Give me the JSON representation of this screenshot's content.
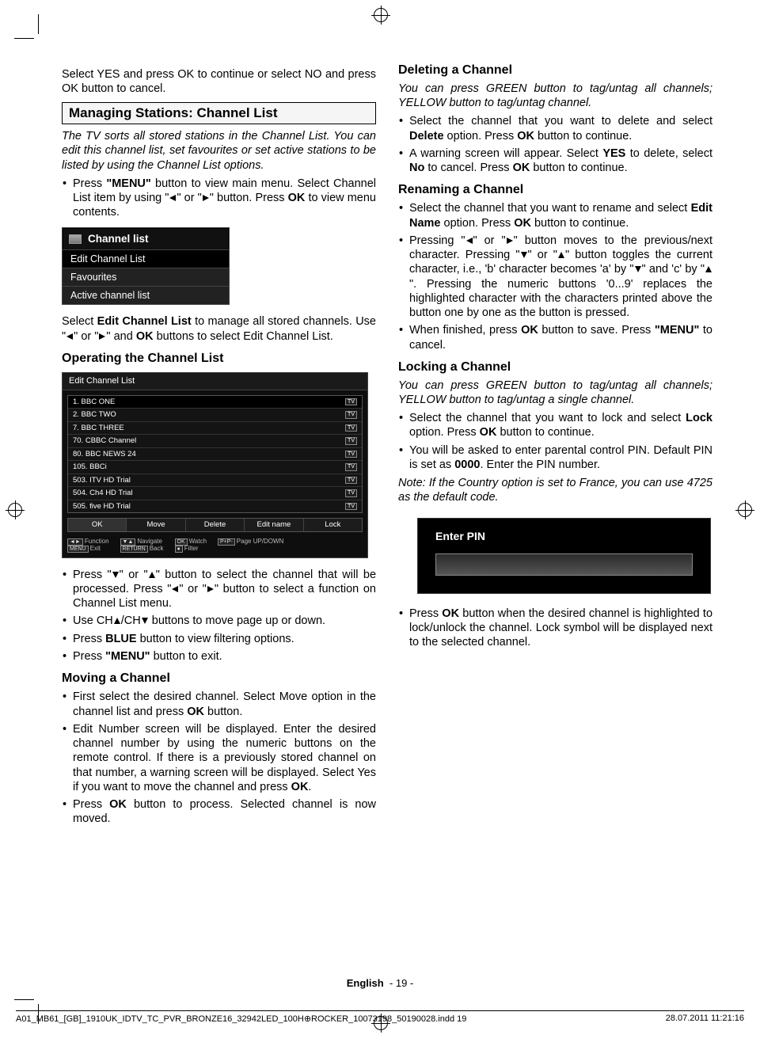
{
  "left": {
    "intro1": "Select YES and press OK to continue or select NO and press OK button to cancel.",
    "h1": "Managing Stations: Channel List",
    "sub_italic": "The TV sorts all stored stations in the Channel List. You can edit this channel list, set favourites or set active stations to be listed by using the Channel List options.",
    "bullet1a": "Press ",
    "bullet1b": " button to view main menu. Select Channel List item by using \"",
    "bullet1c": "\" or \"",
    "bullet1d": "\" button. Press ",
    "bullet1e": " to view menu contents.",
    "menu_word": "\"MENU\"",
    "ok_word": "OK",
    "osd1_title": "Channel list",
    "osd1_items": [
      "Edit Channel List",
      "Favourites",
      "Active channel list"
    ],
    "after_osd1a": "Select ",
    "after_osd1_b": "Edit Channel List",
    "after_osd1c": " to manage all stored channels. Use \"",
    "after_osd1d": "\" or \"",
    "after_osd1e": "\" and ",
    "after_osd1f": " buttons to select Edit Channel List.",
    "h2_operating": "Operating the Channel List",
    "osd2_title": "Edit Channel List",
    "osd2_rows": [
      "1. BBC ONE",
      "2. BBC TWO",
      "7. BBC THREE",
      "70. CBBC Channel",
      "80. BBC NEWS 24",
      "105. BBCi",
      "503. ITV HD Trial",
      "504. Ch4 HD Trial",
      "505. five HD Trial"
    ],
    "osd2_tag": "TV",
    "osd2_btns": [
      "OK",
      "Move",
      "Delete",
      "Edit name",
      "Lock"
    ],
    "osd2_hints": {
      "a": "Function",
      "b": "Exit",
      "c": "Navigate",
      "d": "Back",
      "e": "Watch",
      "f": "Filter",
      "g": "Page UP/DOWN"
    },
    "bl2": [
      "Press \"",
      "\" or \"",
      "\" button to select the channel that will be processed. Press \"",
      "\" or \"",
      "\" button to select a function on Channel List menu."
    ],
    "bl3a": "Use CH",
    "bl3b": "/CH",
    "bl3c": " buttons to move page up or down.",
    "bl4a": "Press ",
    "bl4b": "BLUE",
    "bl4c": " button to view filtering options.",
    "bl5a": "Press ",
    "bl5b": "\"MENU\"",
    "bl5c": " button to exit.",
    "h2_moving": "Moving a Channel",
    "mv1a": "First select the desired channel. Select Move option in the channel list and press ",
    "mv1b": "OK",
    "mv1c": " button.",
    "mv2a": "Edit Number screen will be displayed. Enter the desired channel number by using the numeric buttons on the remote control. If there is a previously stored channel on that number, a warning screen will be displayed. Select Yes if you want to move the channel and press ",
    "mv2b": "OK",
    "mv2c": ".",
    "mv3a": "Press ",
    "mv3b": "OK",
    "mv3c": " button to process. Selected channel is now moved."
  },
  "right": {
    "h2_del": "Deleting a Channel",
    "del_it": "You can press GREEN button to tag/untag all channels; YELLOW button to tag/untag channel.",
    "d1a": "Select the channel that you want to delete and select ",
    "d1b": "Delete",
    "d1c": " option. Press ",
    "d1d": "OK",
    "d1e": " button to continue.",
    "d2a": "A warning screen will appear. Select ",
    "d2b": "YES",
    "d2c": " to delete, select ",
    "d2d": "No",
    "d2e": " to cancel. Press ",
    "d2f": "OK",
    "d2g": " button to continue.",
    "h2_ren": "Renaming a Channel",
    "r1a": "Select the channel that you want to rename and select ",
    "r1b": "Edit Name",
    "r1c": " option. Press ",
    "r1d": "OK",
    "r1e": " button to continue.",
    "r2a": "Pressing \"",
    "r2b": "\" or \"",
    "r2c": "\" button moves to the previous/next character. Pressing \"",
    "r2d": "\" or \"",
    "r2e": "\" button toggles the current character, i.e., 'b' character becomes 'a' by \"",
    "r2f": "\" and 'c' by \"",
    "r2g": "\". Pressing the numeric buttons '0...9' replaces the highlighted character with the characters printed above the button one by one as the button is pressed.",
    "r3a": "When finished, press ",
    "r3b": "OK",
    "r3c": " button to save. Press ",
    "r3d": "\"MENU\"",
    "r3e": " to cancel.",
    "h2_lock": "Locking a Channel",
    "lock_it": "You can press GREEN button to tag/untag all channels; YELLOW button to tag/untag a single channel.",
    "l1a": "Select the channel that you want to lock and select ",
    "l1b": "Lock",
    "l1c": " option. Press ",
    "l1d": "OK",
    "l1e": " button to continue.",
    "l2a": "You will be asked to enter parental control PIN. Default PIN is set as ",
    "l2b": "0000",
    "l2c": ". Enter the PIN number.",
    "note": "Note: If the Country option is set to France, you can use 4725 as the default code.",
    "pin_label": "Enter PIN",
    "after_pin_a": "Press ",
    "after_pin_b": "OK",
    "after_pin_c": " button when the desired channel is highlighted to lock/unlock the channel. Lock symbol will be displayed next to the selected channel."
  },
  "footer": {
    "lang": "English",
    "page": "- 19 -"
  },
  "fileline": {
    "path": "A01_MB61_[GB]_1910UK_IDTV_TC_PVR_BRONZE16_32942LED_100H⊕ROCKER_10073198_50190028.indd   19",
    "ts": "28.07.2011   11:21:16"
  }
}
